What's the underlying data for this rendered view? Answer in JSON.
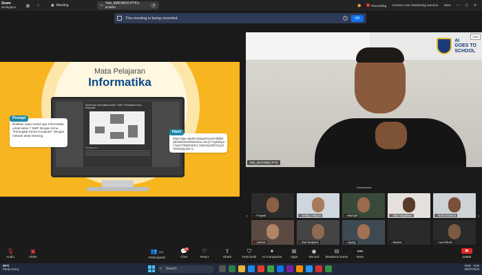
{
  "topbar": {
    "app_name": "Zoom",
    "app_sub": "Workplace",
    "meeting_label": "Meeting",
    "tab_label": "Yoki_MAFINDO PTK's screen",
    "recording_label": "Recording",
    "custom_live": "Custom Live Streaming Service",
    "view_label": "View"
  },
  "banner": {
    "message": "This meeting is being recorded.",
    "ok_label": "OK"
  },
  "slide": {
    "title1": "Mata Pelajaran",
    "title2": "Informatika",
    "doc_title": "Modul Ajar Informatika Kelas 7 SMP: Perangkat Keras Komputer",
    "doc_sub": "Pendahuluan",
    "prompt_tag": "Prompt",
    "prompt_text": "Buatkan saya modul ajar Informatika untuk kelas 7 SMP dengan tema \"Perangkat Keras Komputer\" dengan metode deep learning",
    "hasil_tag": "Hasil",
    "hasil_text": "https://app.napkin.ai/page/CgoiCHBpb2Qtb25lEiwKBFBhZ2Ua JGUyYTg3NDg4LTIwOTItNDE4MC1 hNDU5LWZhYjUxZTRlZWQyZiIx+1"
  },
  "speaker": {
    "name": "Yoki_MAFINDO PTK",
    "logo_line1": "AI",
    "logo_line2": "GOES TO",
    "logo_line3": "SCHOOL",
    "view_badge": "Slide"
  },
  "gallery": {
    "tiles": [
      {
        "name": "Frayadi"
      },
      {
        "name": "Debby Hidayat"
      },
      {
        "name": "Marsudi"
      },
      {
        "name": "Tian Anjadiwan"
      },
      {
        "name": "Rizki Khairma"
      },
      {
        "name": "Jamian"
      },
      {
        "name": "Dwi Wulyanti"
      },
      {
        "name": "Agung"
      },
      {
        "name": "Mazian"
      },
      {
        "name": "nurul khoiri"
      }
    ]
  },
  "toolbar": {
    "audio": "Audio",
    "video": "Video",
    "participants": "Participants",
    "participants_count": "124",
    "chat": "Chat",
    "chat_count": "46",
    "react": "React",
    "share": "Share",
    "host_tools": "Host tools",
    "ai_companion": "AI Companion",
    "apps": "Apps",
    "record": "Record",
    "breakout": "Breakout rooms",
    "more": "More",
    "leave": "Leave"
  },
  "taskbar": {
    "temp": "26°C",
    "weather": "Partly sunny",
    "search_placeholder": "Search",
    "lang": "ENG",
    "time": "9:30",
    "date": "26/07/2025"
  },
  "colors": {
    "slide_bg": "#f7b51f",
    "title_blue": "#0c4a8a",
    "accent_teal": "#1e88a8",
    "banner_bg": "#2e3b57",
    "ok_blue": "#0e72ed",
    "leave_red": "#e02828"
  }
}
